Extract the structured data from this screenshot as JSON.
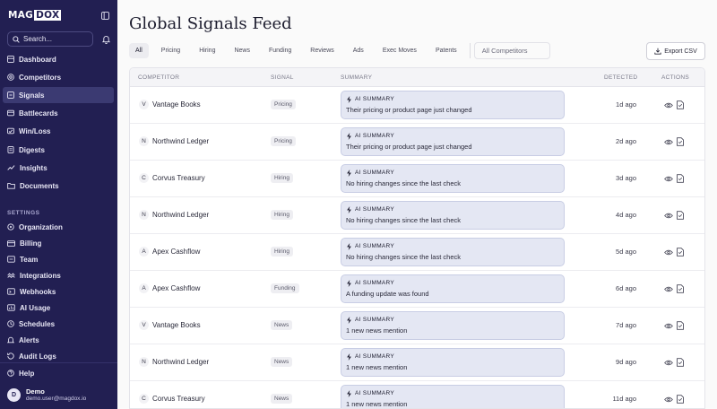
{
  "app": {
    "logo_left": "MAG",
    "logo_box": "DOX"
  },
  "sidebar": {
    "search_label": "Search...",
    "main_nav": [
      {
        "label": "Dashboard",
        "icon": "dashboard-icon"
      },
      {
        "label": "Competitors",
        "icon": "competitors-icon"
      },
      {
        "label": "Signals",
        "icon": "signals-icon",
        "active": true
      },
      {
        "label": "Battlecards",
        "icon": "battlecards-icon"
      },
      {
        "label": "Win/Loss",
        "icon": "winloss-icon"
      },
      {
        "label": "Digests",
        "icon": "digests-icon"
      },
      {
        "label": "Insights",
        "icon": "insights-icon"
      },
      {
        "label": "Documents",
        "icon": "documents-icon"
      }
    ],
    "settings_label": "SETTINGS",
    "settings_nav": [
      {
        "label": "Organization",
        "icon": "organization-icon"
      },
      {
        "label": "Billing",
        "icon": "billing-icon"
      },
      {
        "label": "Team",
        "icon": "team-icon"
      },
      {
        "label": "Integrations",
        "icon": "integrations-icon"
      },
      {
        "label": "Webhooks",
        "icon": "webhooks-icon"
      },
      {
        "label": "AI Usage",
        "icon": "ai-usage-icon"
      },
      {
        "label": "Schedules",
        "icon": "schedules-icon"
      },
      {
        "label": "Alerts",
        "icon": "alerts-icon"
      },
      {
        "label": "Audit Logs",
        "icon": "audit-logs-icon"
      }
    ],
    "help_label": "Help",
    "user": {
      "initial": "D",
      "name": "Demo",
      "email": "demo.user@magdox.io"
    }
  },
  "main": {
    "title": "Global Signals Feed",
    "filters": [
      "All",
      "Pricing",
      "Hiring",
      "News",
      "Funding",
      "Reviews",
      "Ads",
      "Exec Moves",
      "Patents"
    ],
    "active_filter": "All",
    "competitor_select": "All Competitors",
    "export_label": "Export CSV",
    "columns": {
      "competitor": "COMPETITOR",
      "signal": "SIGNAL",
      "summary": "SUMMARY",
      "detected": "DETECTED",
      "actions": "ACTIONS"
    },
    "summary_tag": "AI SUMMARY",
    "rows": [
      {
        "initial": "V",
        "competitor": "Vantage Books",
        "signal": "Pricing",
        "summary": "Their pricing or product page just changed",
        "detected": "1d ago"
      },
      {
        "initial": "N",
        "competitor": "Northwind Ledger",
        "signal": "Pricing",
        "summary": "Their pricing or product page just changed",
        "detected": "2d ago"
      },
      {
        "initial": "C",
        "competitor": "Corvus Treasury",
        "signal": "Hiring",
        "summary": "No hiring changes since the last check",
        "detected": "3d ago"
      },
      {
        "initial": "N",
        "competitor": "Northwind Ledger",
        "signal": "Hiring",
        "summary": "No hiring changes since the last check",
        "detected": "4d ago"
      },
      {
        "initial": "A",
        "competitor": "Apex Cashflow",
        "signal": "Hiring",
        "summary": "No hiring changes since the last check",
        "detected": "5d ago"
      },
      {
        "initial": "A",
        "competitor": "Apex Cashflow",
        "signal": "Funding",
        "summary": "A funding update was found",
        "detected": "6d ago"
      },
      {
        "initial": "V",
        "competitor": "Vantage Books",
        "signal": "News",
        "summary": "1 new news mention",
        "detected": "7d ago"
      },
      {
        "initial": "N",
        "competitor": "Northwind Ledger",
        "signal": "News",
        "summary": "1 new news mention",
        "detected": "9d ago"
      },
      {
        "initial": "C",
        "competitor": "Corvus Treasury",
        "signal": "News",
        "summary": "1 new news mention",
        "detected": "11d ago"
      }
    ]
  },
  "colors": {
    "sidebar_bg": "#221f52",
    "sidebar_active": "#3b3a72",
    "summary_card_bg": "#e4e7f3",
    "summary_card_border": "#c8cde4"
  }
}
